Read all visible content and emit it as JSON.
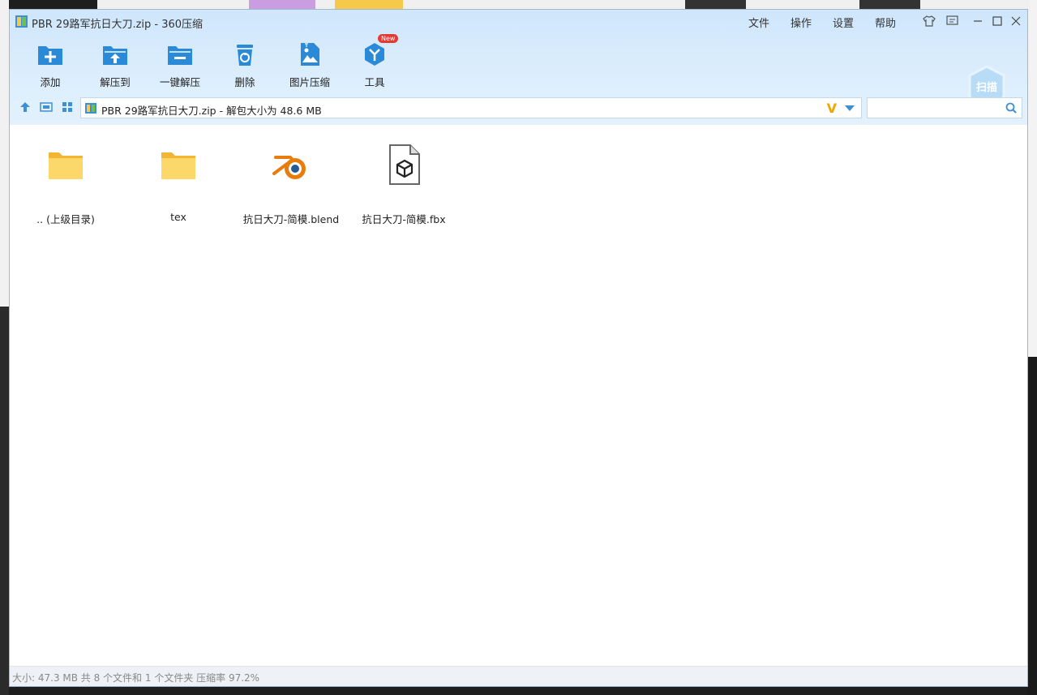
{
  "window": {
    "title": "PBR 29路军抗日大刀.zip - 360压缩",
    "menu": [
      "文件",
      "操作",
      "设置",
      "帮助"
    ]
  },
  "toolbar": {
    "items": [
      {
        "label": "添加",
        "icon": "add-icon"
      },
      {
        "label": "解压到",
        "icon": "extract-to-icon"
      },
      {
        "label": "一键解压",
        "icon": "one-click-extract-icon"
      },
      {
        "label": "删除",
        "icon": "delete-icon"
      },
      {
        "label": "图片压缩",
        "icon": "image-compress-icon"
      },
      {
        "label": "工具",
        "icon": "tools-icon",
        "badge": "New"
      }
    ],
    "scan_label": "扫描"
  },
  "navbar": {
    "path": "PBR 29路军抗日大刀.zip - 解包大小为 48.6 MB",
    "search_value": ""
  },
  "files": [
    {
      "name": ".. (上级目录)",
      "type": "folder"
    },
    {
      "name": "tex",
      "type": "folder"
    },
    {
      "name": "抗日大刀-简模.blend",
      "type": "blend"
    },
    {
      "name": "抗日大刀-简模.fbx",
      "type": "fbx"
    }
  ],
  "status": "大小: 47.3 MB 共 8 个文件和 1 个文件夹 压缩率 97.2%",
  "colors": {
    "accent": "#2b8ad8",
    "header_bg": "#d6eafc",
    "badge": "#e53935",
    "blender_orange": "#e87d0d"
  }
}
